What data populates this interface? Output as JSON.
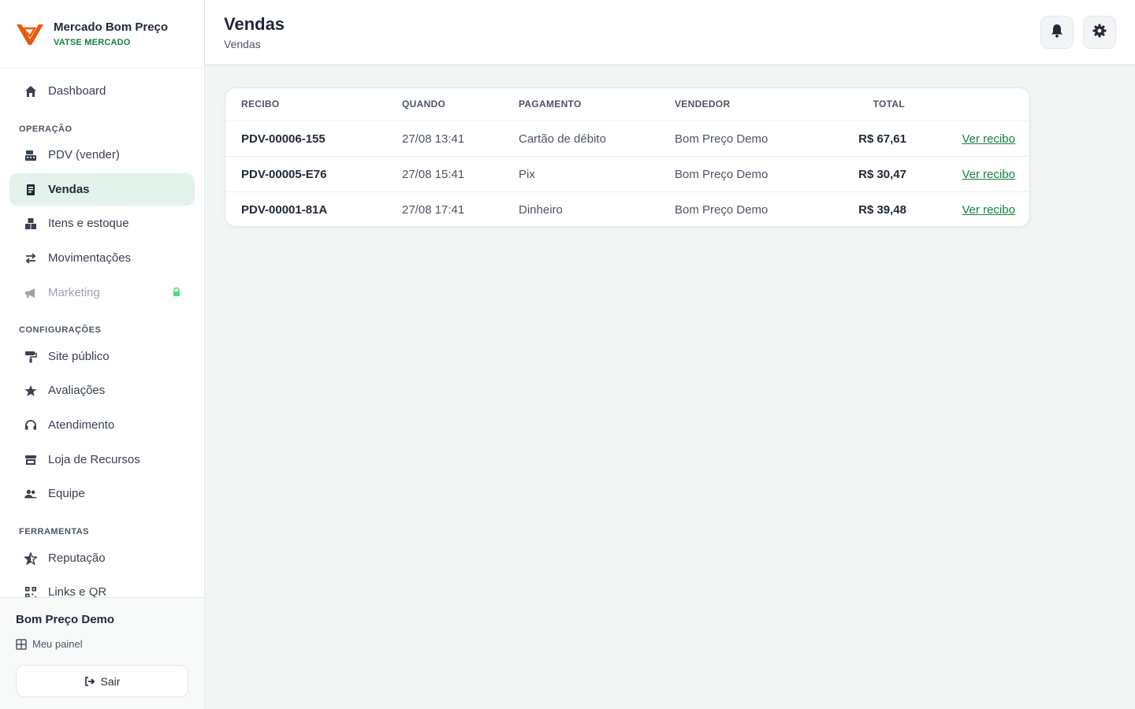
{
  "brand": {
    "name": "Mercado Bom Preço",
    "subtitle": "VATSE MERCADO"
  },
  "nav": {
    "dashboard": "Dashboard",
    "section_operacao": "OPERAÇÃO",
    "pdv": "PDV (vender)",
    "vendas": "Vendas",
    "itens": "Itens e estoque",
    "movimentacoes": "Movimentações",
    "marketing": "Marketing",
    "section_config": "CONFIGURAÇÕES",
    "site": "Site público",
    "avaliacoes": "Avaliações",
    "atendimento": "Atendimento",
    "loja": "Loja de Recursos",
    "equipe": "Equipe",
    "section_ferramentas": "FERRAMENTAS",
    "reputacao": "Reputação",
    "links": "Links e QR"
  },
  "footer": {
    "user": "Bom Preço Demo",
    "panel": "Meu painel",
    "logout": "Sair"
  },
  "header": {
    "title": "Vendas",
    "crumb": "Vendas"
  },
  "table": {
    "headers": {
      "recibo": "RECIBO",
      "quando": "QUANDO",
      "pagamento": "PAGAMENTO",
      "vendedor": "VENDEDOR",
      "total": "TOTAL"
    },
    "rows": [
      {
        "recibo": "PDV-00006-155",
        "quando": "27/08 13:41",
        "pagamento": "Cartão de débito",
        "vendedor": "Bom Preço Demo",
        "total": "R$ 67,61",
        "link": "Ver recibo"
      },
      {
        "recibo": "PDV-00005-E76",
        "quando": "27/08 15:41",
        "pagamento": "Pix",
        "vendedor": "Bom Preço Demo",
        "total": "R$ 30,47",
        "link": "Ver recibo"
      },
      {
        "recibo": "PDV-00001-81A",
        "quando": "27/08 17:41",
        "pagamento": "Dinheiro",
        "vendedor": "Bom Preço Demo",
        "total": "R$ 39,48",
        "link": "Ver recibo"
      }
    ]
  },
  "colors": {
    "accent": "#15803d",
    "active_bg": "#e3f2ea",
    "logo": "#ea580c"
  }
}
